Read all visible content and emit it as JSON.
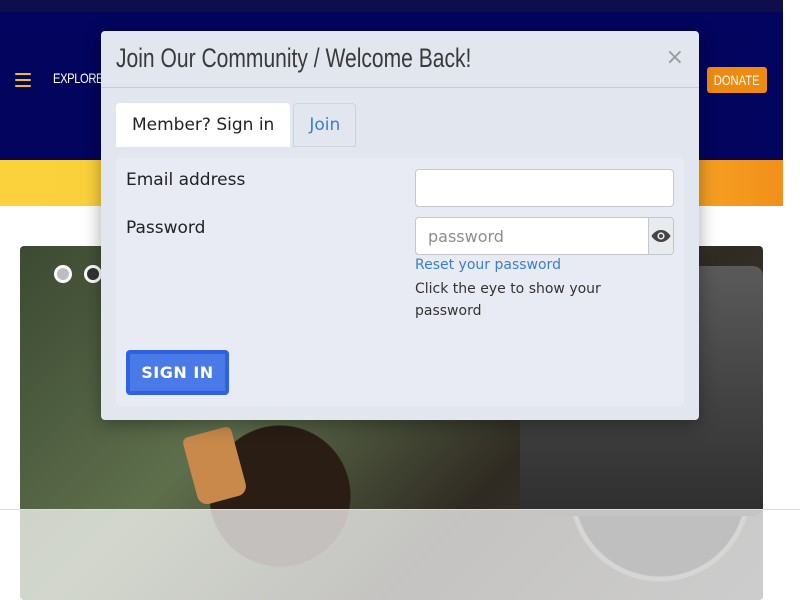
{
  "header": {
    "menu_icon": "hamburger-menu-icon",
    "explore_label": "Explore",
    "donate_label": "Donate"
  },
  "hero": {
    "slides": 2,
    "active_slide": 2
  },
  "modal": {
    "title": "Join Our Community / Welcome Back!",
    "close_symbol": "×",
    "tabs": [
      {
        "label": "Member? Sign in",
        "active": true
      },
      {
        "label": "Join",
        "active": false
      }
    ],
    "email_label": "Email address",
    "email_value": "",
    "password_label": "Password",
    "password_placeholder": "password",
    "eye_icon": "eye-icon",
    "reset_link": "Reset your password",
    "help_text": "Click the eye to show your password",
    "signin_label": "SIGN IN"
  },
  "colors": {
    "header_bg": "#03045e",
    "donate_bg": "#ef8a10",
    "banner_yellow": "#fbd23c",
    "link_blue": "#3b7fc9",
    "button_blue": "#4a7ae8",
    "modal_bg": "#e2e6ee"
  }
}
